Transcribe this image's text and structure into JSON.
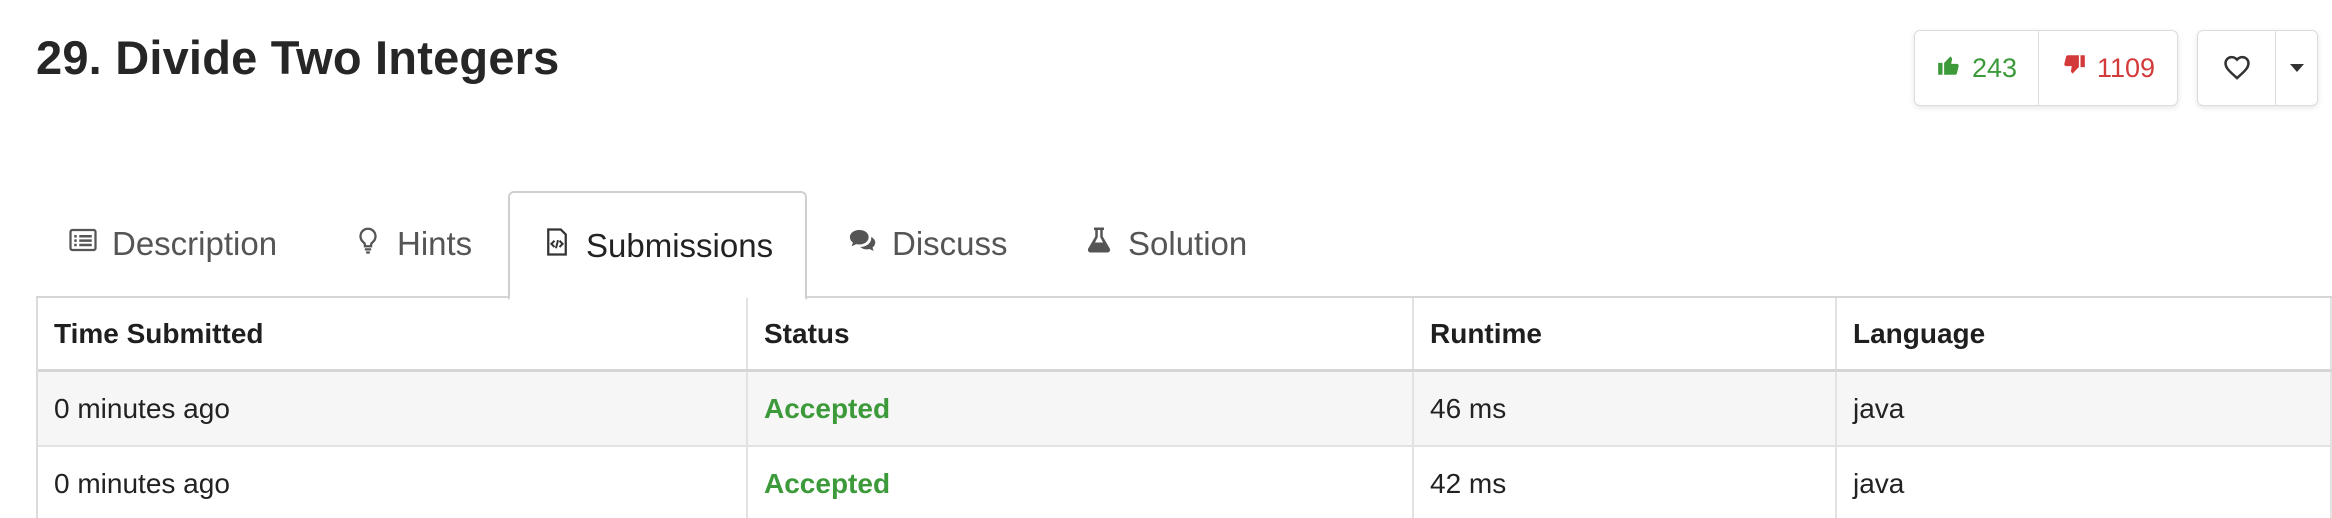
{
  "problem": {
    "title": "29. Divide Two Integers"
  },
  "votes": {
    "likes": "243",
    "dislikes": "1109"
  },
  "tabs": [
    {
      "label": "Description",
      "icon": "description-icon"
    },
    {
      "label": "Hints",
      "icon": "lightbulb-icon"
    },
    {
      "label": "Submissions",
      "icon": "code-file-icon",
      "active": true
    },
    {
      "label": "Discuss",
      "icon": "chat-bubbles-icon"
    },
    {
      "label": "Solution",
      "icon": "flask-icon"
    }
  ],
  "table": {
    "headers": [
      "Time Submitted",
      "Status",
      "Runtime",
      "Language"
    ],
    "rows": [
      {
        "time": "0 minutes ago",
        "status": "Accepted",
        "runtime": "46 ms",
        "language": "java"
      },
      {
        "time": "0 minutes ago",
        "status": "Accepted",
        "runtime": "42 ms",
        "language": "java"
      }
    ]
  },
  "colors": {
    "accepted": "#3c9a3a",
    "like": "#3c9a3a",
    "dislike": "#d33a3a"
  }
}
